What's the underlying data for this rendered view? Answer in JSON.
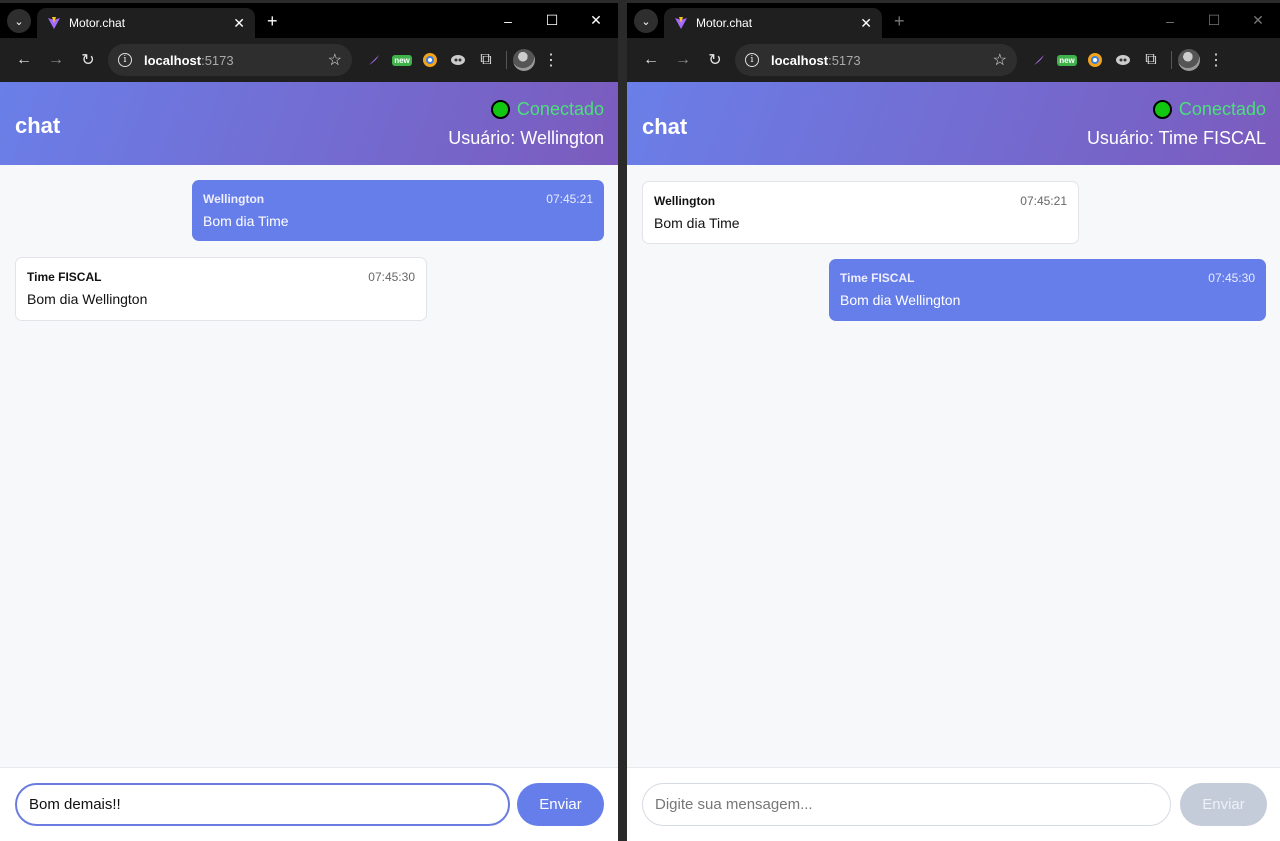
{
  "windows": [
    {
      "id": "left",
      "tab_title": "Motor.chat",
      "url_host": "localhost",
      "url_port": ":5173",
      "chat_title": "chat",
      "status": "Conectado",
      "user_label": "Usuário: Wellington",
      "messages": [
        {
          "sender": "Wellington",
          "time": "07:45:21",
          "text": "Bom dia Time",
          "mine": true
        },
        {
          "sender": "Time FISCAL",
          "time": "07:45:30",
          "text": "Bom dia Wellington",
          "mine": false
        }
      ],
      "input_value": "Bom demais!!",
      "input_placeholder": "Digite sua mensagem...",
      "send_label": "Enviar"
    },
    {
      "id": "right",
      "tab_title": "Motor.chat",
      "url_host": "localhost",
      "url_port": ":5173",
      "chat_title": "chat",
      "status": "Conectado",
      "user_label": "Usuário: Time FISCAL",
      "messages": [
        {
          "sender": "Wellington",
          "time": "07:45:21",
          "text": "Bom dia Time",
          "mine": false
        },
        {
          "sender": "Time FISCAL",
          "time": "07:45:30",
          "text": "Bom dia Wellington",
          "mine": true
        }
      ],
      "input_value": "",
      "input_placeholder": "Digite sua mensagem...",
      "send_label": "Enviar"
    }
  ],
  "icons": {
    "back": "←",
    "forward": "→",
    "reload": "↻",
    "star": "☆",
    "close": "✕",
    "minimize": "–",
    "maximize": "☐",
    "newtab": "+",
    "menu": "⋮",
    "chevron": "⌄",
    "extensions": "⧉",
    "new_badge": "new"
  },
  "colors": {
    "accent": "#667eea",
    "header_gradient_start": "#6a7fe8",
    "header_gradient_end": "#7b5bbd",
    "status_green": "#4ae07a",
    "send_disabled": "#c5ccd9"
  }
}
